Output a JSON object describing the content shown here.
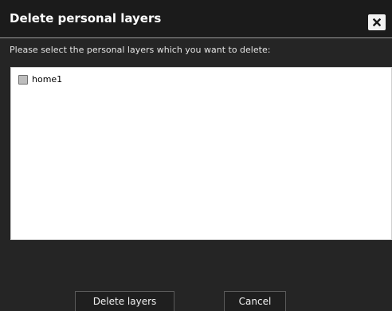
{
  "dialog": {
    "title": "Delete personal layers",
    "instruction": "Please select the personal layers which you want to delete:"
  },
  "layers": [
    {
      "label": "home1",
      "checked": false
    }
  ],
  "buttons": {
    "delete_label": "Delete layers",
    "cancel_label": "Cancel"
  },
  "icons": {
    "close": "close-icon"
  },
  "colors": {
    "titlebar_bg": "#1b1b1b",
    "dialog_bg": "#252525",
    "list_bg": "#ffffff",
    "text": "#ffffff"
  }
}
